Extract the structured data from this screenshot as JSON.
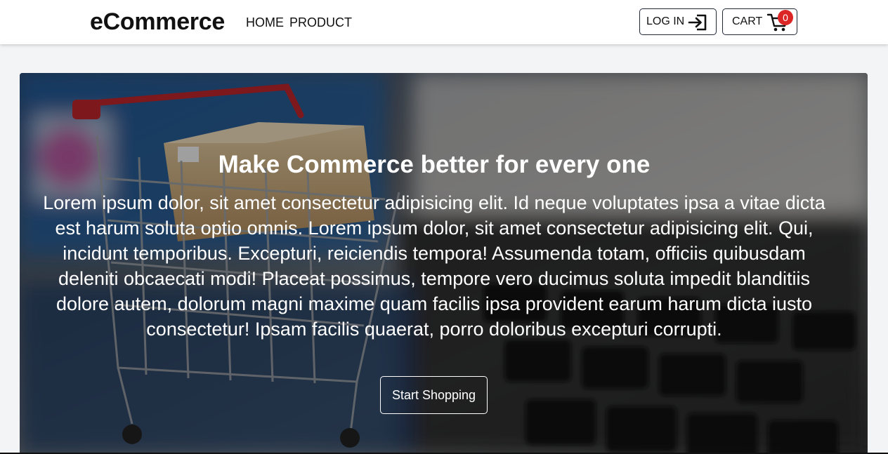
{
  "navbar": {
    "brand": "eCommerce",
    "links": [
      "HOME",
      "PRODUCT"
    ],
    "login_label": "LOG IN",
    "cart_label": "CART",
    "cart_count": "0"
  },
  "hero": {
    "title": "Make Commerce better for every one",
    "description": "Lorem ipsum dolor, sit amet consectetur adipisicing elit. Id neque voluptates ipsa a vitae dicta est harum soluta optio omnis. Lorem ipsum dolor, sit amet consectetur adipisicing elit. Qui, incidunt temporibus. Excepturi, reiciendis tempora! Assumenda totam, officiis quibusdam deleniti obcaecati modi! Placeat possimus, tempore vero ducimus soluta impedit blanditiis dolore autem, dolorum magni maxime quam facilis ipsa provident earum harum dicta iusto consectetur! Ipsam facilis quaerat, porro doloribus excepturi corrupti.",
    "cta_label": "Start Shopping"
  },
  "icons": {
    "login": "login-arrow-icon",
    "cart": "shopping-cart-icon"
  },
  "colors": {
    "badge": "#dc2626",
    "page_background": "#f3f4f6",
    "navbar_background": "#ffffff"
  }
}
